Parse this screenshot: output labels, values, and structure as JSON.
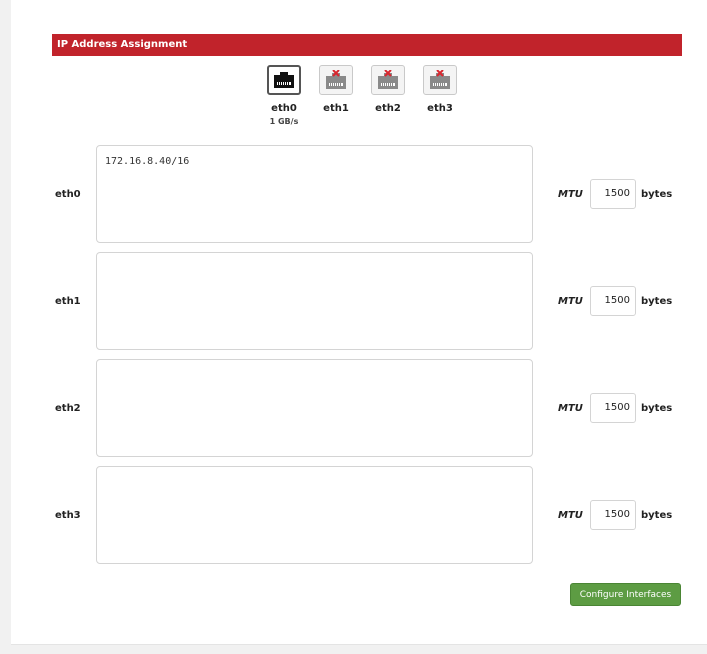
{
  "section": {
    "title": "IP Address Assignment"
  },
  "ports": [
    {
      "name": "eth0",
      "speed": "1 GB/s",
      "connected": true
    },
    {
      "name": "eth1",
      "speed": "",
      "connected": false
    },
    {
      "name": "eth2",
      "speed": "",
      "connected": false
    },
    {
      "name": "eth3",
      "speed": "",
      "connected": false
    }
  ],
  "interfaces": [
    {
      "label": "eth0",
      "addresses": "172.16.8.40/16",
      "mtu_label": "MTU",
      "mtu": "1500",
      "unit": "bytes"
    },
    {
      "label": "eth1",
      "addresses": "",
      "mtu_label": "MTU",
      "mtu": "1500",
      "unit": "bytes"
    },
    {
      "label": "eth2",
      "addresses": "",
      "mtu_label": "MTU",
      "mtu": "1500",
      "unit": "bytes"
    },
    {
      "label": "eth3",
      "addresses": "",
      "mtu_label": "MTU",
      "mtu": "1500",
      "unit": "bytes"
    }
  ],
  "actions": {
    "configure_label": "Configure Interfaces"
  },
  "colors": {
    "header": "#c1232b",
    "button": "#5d9c43",
    "disconnected_mark": "#d9262e"
  }
}
